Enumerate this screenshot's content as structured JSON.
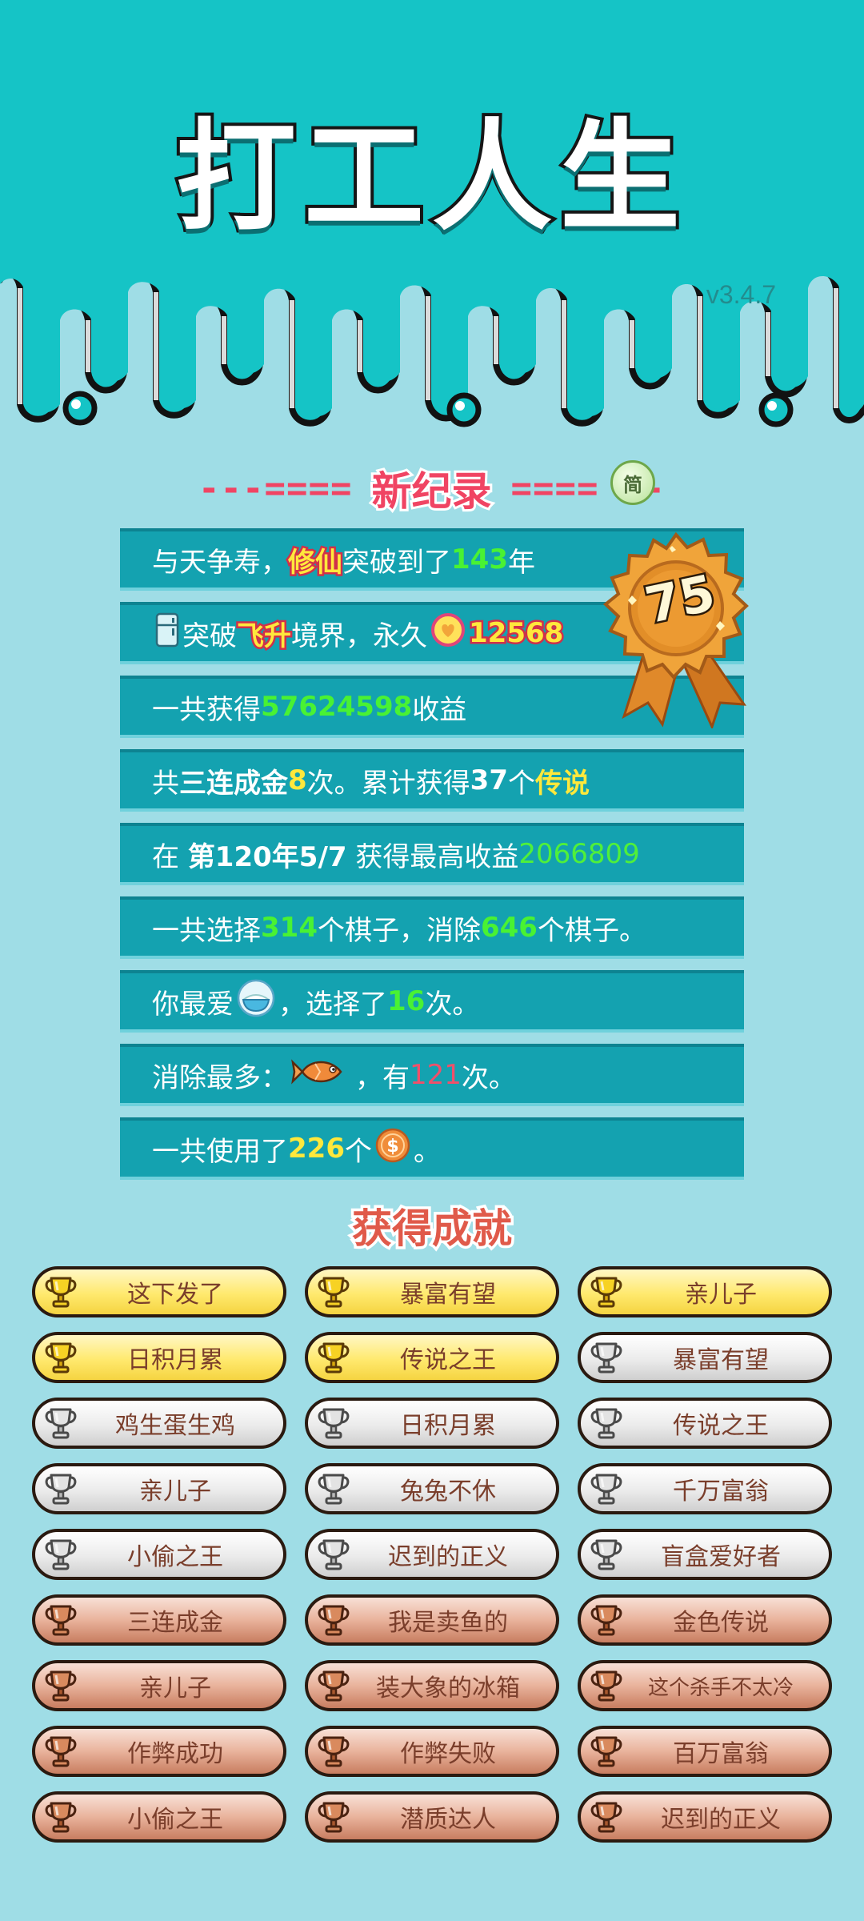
{
  "app_title": "打工人生",
  "version": "v3.4.7",
  "record_header": {
    "dash_left": "---====",
    "title": "新纪录",
    "dash_right": "====",
    "dash_tail": "-",
    "badge": "简"
  },
  "medal": {
    "number": "75"
  },
  "stats": {
    "row1": {
      "t1": "与天争寿，",
      "t2": "修仙",
      "t3": "突破到了",
      "t4": "143",
      "t5": "年"
    },
    "row2": {
      "t1": "突破",
      "t2": "飞升",
      "t3": "境界，永久",
      "t4": "12568"
    },
    "row3": {
      "t1": "一共获得",
      "t2": "57624598",
      "t3": "收益"
    },
    "row4": {
      "t1": "共",
      "t2": "三连成金",
      "t3": "8",
      "t4": "次。累计获得",
      "t5": "37",
      "t6": "个",
      "t7": "传说"
    },
    "row5": {
      "t1": "在 ",
      "t2": "第120年5/7",
      "t3": " 获得最高收益",
      "t4": "2066809"
    },
    "row6": {
      "t1": "一共选择",
      "t2": "314",
      "t3": "个棋子，消除",
      "t4": "646",
      "t5": "个棋子。"
    },
    "row7": {
      "t1": "你最爱",
      "t2": "，选择了",
      "t3": "16",
      "t4": "次。"
    },
    "row8": {
      "t1": "消除最多：",
      "t2": "，有",
      "t3": "121",
      "t4": "次。"
    },
    "row9": {
      "t1": "一共使用了",
      "t2": "226",
      "t3": "个",
      "t4": "。"
    }
  },
  "achievements_title": "获得成就",
  "achievements": [
    {
      "label": "这下发了",
      "tier": "gold"
    },
    {
      "label": "暴富有望",
      "tier": "gold"
    },
    {
      "label": "亲儿子",
      "tier": "gold"
    },
    {
      "label": "日积月累",
      "tier": "gold"
    },
    {
      "label": "传说之王",
      "tier": "gold"
    },
    {
      "label": "暴富有望",
      "tier": "silver"
    },
    {
      "label": "鸡生蛋生鸡",
      "tier": "silver"
    },
    {
      "label": "日积月累",
      "tier": "silver"
    },
    {
      "label": "传说之王",
      "tier": "silver"
    },
    {
      "label": "亲儿子",
      "tier": "silver"
    },
    {
      "label": "兔兔不休",
      "tier": "silver"
    },
    {
      "label": "千万富翁",
      "tier": "silver"
    },
    {
      "label": "小偷之王",
      "tier": "silver"
    },
    {
      "label": "迟到的正义",
      "tier": "silver"
    },
    {
      "label": "盲盒爱好者",
      "tier": "silver"
    },
    {
      "label": "三连成金",
      "tier": "bronze"
    },
    {
      "label": "我是卖鱼的",
      "tier": "bronze"
    },
    {
      "label": "金色传说",
      "tier": "bronze"
    },
    {
      "label": "亲儿子",
      "tier": "bronze"
    },
    {
      "label": "装大象的冰箱",
      "tier": "bronze"
    },
    {
      "label": "这个杀手不太冷",
      "tier": "bronze"
    },
    {
      "label": "作弊成功",
      "tier": "bronze"
    },
    {
      "label": "作弊失败",
      "tier": "bronze"
    },
    {
      "label": "百万富翁",
      "tier": "bronze"
    },
    {
      "label": "小偷之王",
      "tier": "bronze"
    },
    {
      "label": "潜质达人",
      "tier": "bronze"
    },
    {
      "label": "迟到的正义",
      "tier": "bronze"
    }
  ],
  "colors": {
    "header_teal": "#15c4c6",
    "background": "#9fdde6",
    "row_bg": "#14a2b0",
    "accent_red": "#f04463",
    "highlight_yellow": "#ffe83c",
    "highlight_green": "#49f233",
    "gold_tier": "#ffe96e",
    "silver_tier": "#ebebeb",
    "bronze_tier": "#e9b39c"
  },
  "icons": {
    "row2_left": "fridge-icon",
    "row2_currency": "heart-coin-icon",
    "row7_piece": "rice-bowl-icon",
    "row8_piece": "fish-icon",
    "row9_currency": "coin-icon",
    "trophy": "trophy-icon",
    "medal": "rosette-medal-icon"
  }
}
